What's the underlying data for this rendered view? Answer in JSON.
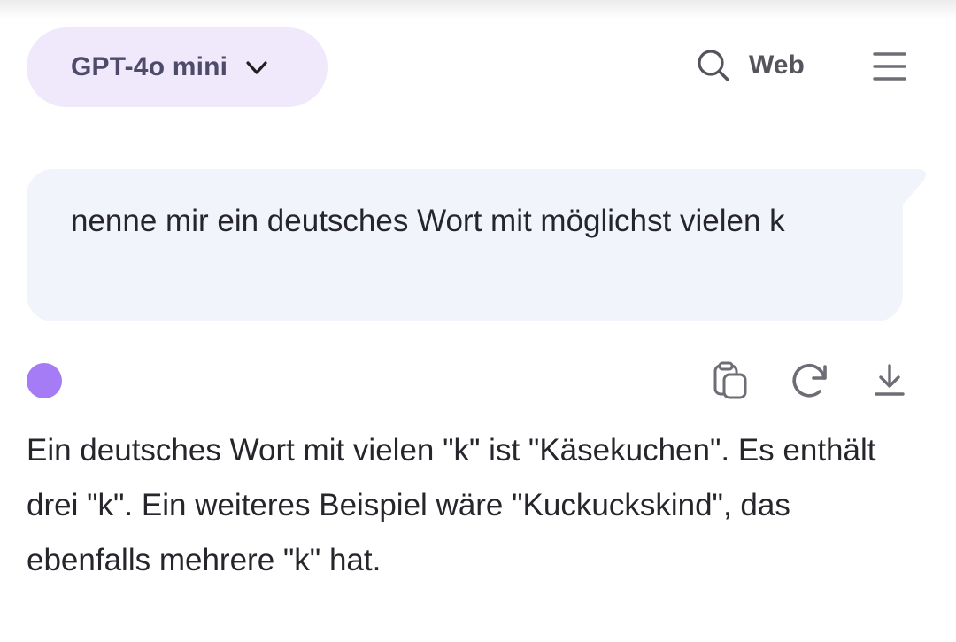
{
  "header": {
    "model_label": "GPT-4o mini",
    "web_label": "Web",
    "icons": [
      "chevron-down-icon",
      "search-icon",
      "menu-icon"
    ]
  },
  "conversation": {
    "user_message": "nenne mir ein deutsches Wort mit möglichst vielen k",
    "assistant_message": "Ein deutsches Wort mit vielen \"k\" ist \"Käsekuchen\". Es enthält drei \"k\". Ein weiteres Beispiel wäre \"Kuckuckskind\", das ebenfalls mehrere \"k\" hat.",
    "actions": [
      "copy-icon",
      "regenerate-icon",
      "download-icon"
    ]
  },
  "colors": {
    "pill_background": "#efe9fb",
    "user_bubble": "#f1f4fb",
    "avatar": "#a57cf6",
    "icon_gray": "#6e6d75"
  }
}
